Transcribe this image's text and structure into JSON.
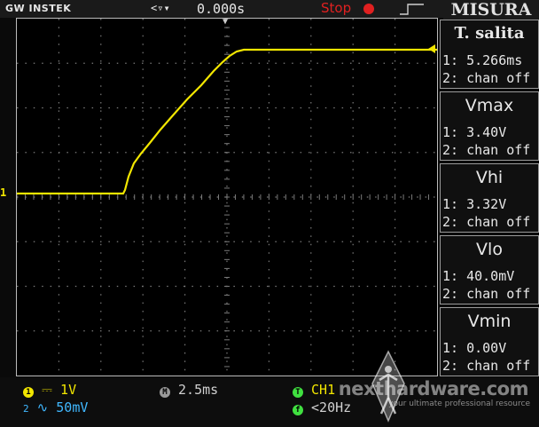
{
  "topbar": {
    "brand": "GW INSTEK",
    "trigger_position": "0.000s",
    "run_state": "Stop",
    "menu_title": "MISURA"
  },
  "colors": {
    "ch1": "#f2e600",
    "ch2": "#40b8ff",
    "stop": "#e02020",
    "grid": "#7a7a7a"
  },
  "measurements": [
    {
      "name": "T. salita",
      "ch1": "1: 5.266ms",
      "ch2": "2: chan off"
    },
    {
      "name": "Vmax",
      "ch1": "1: 3.40V",
      "ch2": "2: chan off"
    },
    {
      "name": "Vhi",
      "ch1": "1: 3.32V",
      "ch2": "2: chan off"
    },
    {
      "name": "Vlo",
      "ch1": "1: 40.0mV",
      "ch2": "2: chan off"
    },
    {
      "name": "Vmin",
      "ch1": "1: 0.00V",
      "ch2": "2: chan off"
    }
  ],
  "channel_markers": {
    "ch1": "1"
  },
  "bottombar": {
    "ch1_badge": "1",
    "ch1_coupling": "⎓",
    "ch1_scale": "1V",
    "ch2_badge": "2",
    "ch2_coupling": "∿",
    "ch2_scale": "50mV",
    "timebase_badge": "M",
    "timebase": "2.5ms",
    "trigger_badge": "T",
    "trigger_source": "CH1",
    "freq_badge": "f",
    "trigger_frequency": "<20Hz"
  },
  "watermark": {
    "site": "nexthardware.com",
    "tagline": "your ultimate professional resource"
  },
  "icons": {
    "trigger_position": "trigger-position-arrows-icon",
    "stop": "stop-dot-icon",
    "trigger_mode": "rising-edge-icon"
  }
}
